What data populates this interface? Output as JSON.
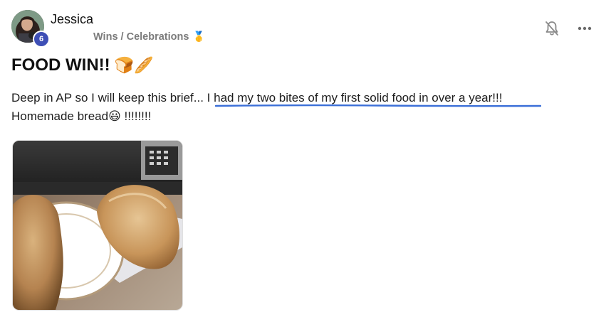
{
  "author": {
    "name": "Jessica",
    "level": "6",
    "category": "Wins / Celebrations",
    "category_icon": "🥇"
  },
  "actions": {
    "bell_icon": "bell-off-icon",
    "more_icon": "more-horizontal-icon"
  },
  "post": {
    "title": "FOOD WIN!!",
    "title_emojis": "🍞🥖",
    "body_intro": "Deep in AP so I will keep this brief...",
    "body_highlight": "I had my two bites of my first solid food in over a year!!!",
    "body_line2": "Homemade bread",
    "body_emoji": "😃",
    "body_end": "!!!!!!!!"
  },
  "colors": {
    "level_badge": "#3e4fb6",
    "underline": "#3b6fd8",
    "category_text": "#7b7b7b"
  }
}
